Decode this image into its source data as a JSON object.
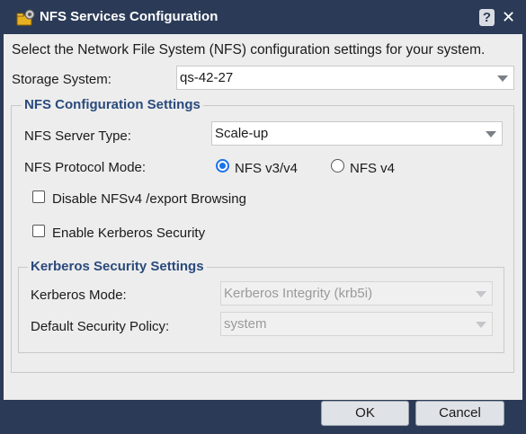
{
  "window": {
    "title": "NFS Services Configuration",
    "help_label": "?",
    "close_label": "✕"
  },
  "intro_text": "Select the Network File System (NFS) configuration settings for your system.",
  "storage_system": {
    "label": "Storage System:",
    "value": "qs-42-27"
  },
  "nfs_settings": {
    "legend": "NFS Configuration Settings",
    "server_type_label": "NFS Server Type:",
    "server_type_value": "Scale-up",
    "protocol_label": "NFS Protocol Mode:",
    "protocol_options": [
      "NFS v3/v4",
      "NFS v4"
    ],
    "protocol_selected": "NFS v3/v4",
    "disable_export_browsing_label": "Disable NFSv4 /export Browsing",
    "disable_export_browsing_checked": false,
    "enable_kerberos_label": "Enable Kerberos Security",
    "enable_kerberos_checked": false
  },
  "kerberos_settings": {
    "legend": "Kerberos Security Settings",
    "mode_label": "Kerberos Mode:",
    "mode_value": "Kerberos Integrity (krb5i)",
    "policy_label": "Default Security Policy:",
    "policy_value": "system",
    "disabled": true
  },
  "footer": {
    "ok_label": "OK",
    "cancel_label": "Cancel"
  },
  "colors": {
    "titlebar": "#2b3b57",
    "legend_text": "#2a4a7c",
    "radio_accent": "#1a73e8",
    "body_bg": "#ededed"
  },
  "icons": {
    "title_icon": "nfs-services-icon",
    "help": "help-icon",
    "close": "close-icon",
    "dropdown": "chevron-down-icon"
  }
}
